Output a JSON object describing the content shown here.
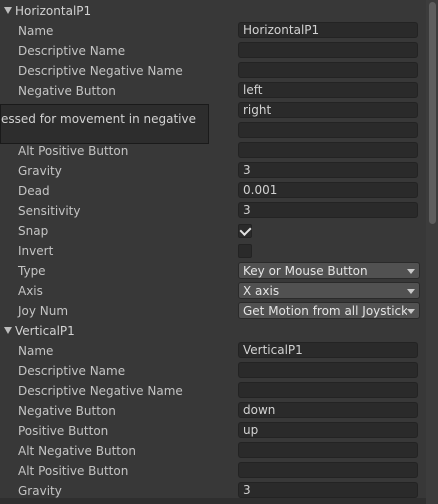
{
  "axes": [
    {
      "title": "HorizontalP1",
      "name_label": "Name",
      "name_value": "HorizontalP1",
      "desc_label": "Descriptive Name",
      "desc_value": "",
      "desc_neg_label": "Descriptive Negative Name",
      "desc_neg_value": "",
      "neg_label": "Negative Button",
      "neg_value": "left",
      "pos_value": "right",
      "alt_neg_value": "",
      "alt_pos_label": "Alt Positive Button",
      "alt_pos_value": "",
      "gravity_label": "Gravity",
      "gravity_value": "3",
      "dead_label": "Dead",
      "dead_value": "0.001",
      "sens_label": "Sensitivity",
      "sens_value": "3",
      "snap_label": "Snap",
      "snap_checked": true,
      "invert_label": "Invert",
      "invert_checked": false,
      "type_label": "Type",
      "type_value": "Key or Mouse Button",
      "axis_label": "Axis",
      "axis_value": "X axis",
      "joy_label": "Joy Num",
      "joy_value": "Get Motion from all Joysticks"
    },
    {
      "title": "VerticalP1",
      "name_label": "Name",
      "name_value": "VerticalP1",
      "desc_label": "Descriptive Name",
      "desc_value": "",
      "desc_neg_label": "Descriptive Negative Name",
      "desc_neg_value": "",
      "neg_label": "Negative Button",
      "neg_value": "down",
      "pos_label": "Positive Button",
      "pos_value": "up",
      "alt_neg_label": "Alt Negative Button",
      "alt_neg_value": "",
      "alt_pos_label": "Alt Positive Button",
      "alt_pos_value": "",
      "gravity_label": "Gravity",
      "gravity_value": "3"
    }
  ],
  "tooltip": {
    "text": "essed for movement in negative"
  }
}
